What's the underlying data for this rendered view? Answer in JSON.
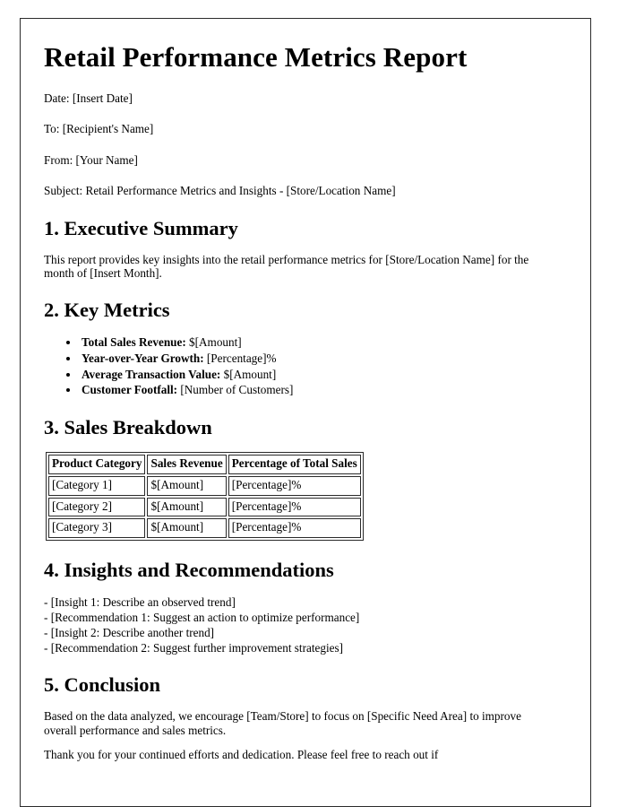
{
  "document": {
    "title": "Retail Performance Metrics Report",
    "meta": [
      {
        "name": "date",
        "text": "Date: [Insert Date]"
      },
      {
        "name": "to",
        "text": "To: [Recipient's Name]"
      },
      {
        "name": "from",
        "text": "From: [Your Name]"
      },
      {
        "name": "subject",
        "text": "Subject: Retail Performance Metrics and Insights - [Store/Location Name]"
      }
    ],
    "sections": {
      "executive_summary": {
        "heading": "1. Executive Summary",
        "paragraph": "This report provides key insights into the retail performance metrics for [Store/Location Name] for the month of [Insert Month]."
      },
      "key_metrics": {
        "heading": "2. Key Metrics",
        "items": [
          {
            "label": "Total Sales Revenue:",
            "value": " $[Amount]"
          },
          {
            "label": "Year-over-Year Growth:",
            "value": " [Percentage]%"
          },
          {
            "label": "Average Transaction Value:",
            "value": " $[Amount]"
          },
          {
            "label": "Customer Footfall:",
            "value": " [Number of Customers]"
          }
        ]
      },
      "sales_breakdown": {
        "heading": "3. Sales Breakdown",
        "table": {
          "columns": [
            "Product Category",
            "Sales Revenue",
            "Percentage of Total Sales"
          ],
          "rows": [
            [
              "[Category 1]",
              "$[Amount]",
              "[Percentage]%"
            ],
            [
              "[Category 2]",
              "$[Amount]",
              "[Percentage]%"
            ],
            [
              "[Category 3]",
              "$[Amount]",
              "[Percentage]%"
            ]
          ]
        }
      },
      "insights": {
        "heading": "4. Insights and Recommendations",
        "lines": [
          "- [Insight 1: Describe an observed trend]",
          "- [Recommendation 1: Suggest an action to optimize performance]",
          "- [Insight 2: Describe another trend]",
          "- [Recommendation 2: Suggest further improvement strategies]"
        ]
      },
      "conclusion": {
        "heading": "5. Conclusion",
        "paragraph": "Based on the data analyzed, we encourage [Team/Store] to focus on [Specific Need Area] to improve overall performance and sales metrics.",
        "closing": "Thank you for your continued efforts and dedication. Please feel free to reach out if"
      }
    }
  }
}
